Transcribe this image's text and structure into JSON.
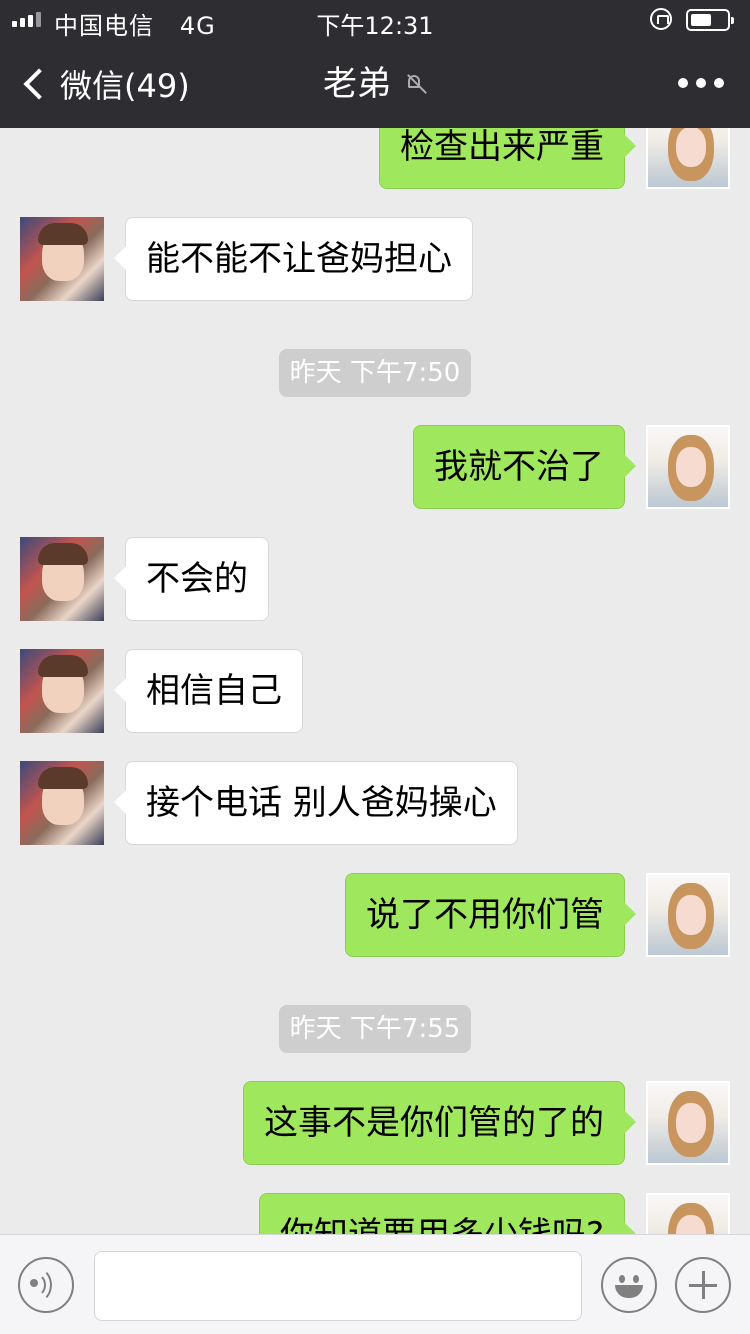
{
  "status_bar": {
    "carrier": "中国电信",
    "network": "4G",
    "time": "下午12:31"
  },
  "nav": {
    "back_label": "微信(49)",
    "title": "老弟",
    "mute_icon": "bell-slash-icon",
    "more_icon": "more-dots-icon"
  },
  "messages": [
    {
      "side": "out",
      "text": "检查出来严重"
    },
    {
      "side": "in",
      "text": "能不能不让爸妈担心"
    },
    {
      "type": "time",
      "text": "昨天 下午7:50"
    },
    {
      "side": "out",
      "text": "我就不治了"
    },
    {
      "side": "in",
      "text": "不会的"
    },
    {
      "side": "in",
      "text": "相信自己"
    },
    {
      "side": "in",
      "text": "接个电话 别人爸妈操心"
    },
    {
      "side": "out",
      "text": "说了不用你们管"
    },
    {
      "type": "time",
      "text": "昨天 下午7:55"
    },
    {
      "side": "out",
      "text": "这事不是你们管的了的"
    },
    {
      "side": "out",
      "text": "你知道要用多少钱吗?"
    }
  ],
  "input_bar": {
    "voice_icon": "voice-icon",
    "emoji_icon": "emoji-icon",
    "plus_icon": "plus-icon",
    "text_value": ""
  },
  "colors": {
    "nav_bg": "#2e2d32",
    "chat_bg": "#ebebeb",
    "outgoing_bubble": "#9fe85d",
    "incoming_bubble": "#ffffff",
    "time_chip": "#cecece"
  }
}
